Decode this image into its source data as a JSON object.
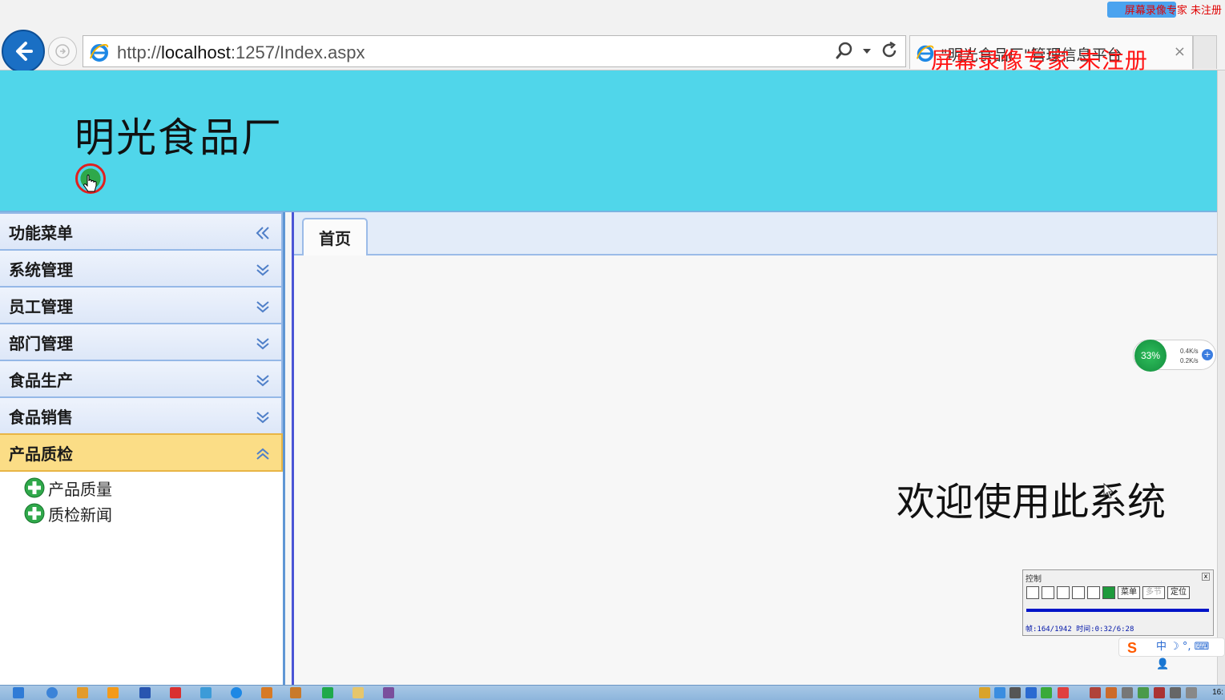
{
  "browser": {
    "url_prefix": "http://",
    "url_host": "localhost",
    "url_rest": ":1257/Index.aspx",
    "tab_title": "\"明光食品厂\"管理信息平台",
    "tab_close": "×",
    "watermark": "屏幕录像专家 未注册",
    "watermark_small": "屏幕录像专家 未注册"
  },
  "header": {
    "brand": "明光食品厂"
  },
  "sidebar": {
    "title": "功能菜单",
    "items": [
      {
        "label": "系统管理",
        "expanded": false
      },
      {
        "label": "员工管理",
        "expanded": false
      },
      {
        "label": "部门管理",
        "expanded": false
      },
      {
        "label": "食品生产",
        "expanded": false
      },
      {
        "label": "食品销售",
        "expanded": false
      },
      {
        "label": "产品质检",
        "expanded": true
      }
    ],
    "tree": [
      {
        "label": "产品质量"
      },
      {
        "label": "质检新闻"
      }
    ]
  },
  "main": {
    "tab_home": "首页",
    "welcome": "欢迎使用此系统"
  },
  "net_widget": {
    "percent": "33%",
    "up": "0.4K/s",
    "down": "0.2K/s",
    "plus": "+"
  },
  "recorder": {
    "title": "控制",
    "close": "x",
    "btn_menu": "菜单",
    "btn_multi": "多节",
    "btn_locate": "定位",
    "info": "帧:164/1942 时间:0:32/6:28"
  },
  "ime": {
    "logo": "S",
    "text": "中 ☽ °, ⌨ 👤"
  },
  "taskbar": {
    "clock": "16:"
  },
  "colors": {
    "header_bg": "#50d6ea",
    "sidebar_active": "#fbdd86",
    "accent_blue": "#5f96d4",
    "watermark_red": "#ff1414"
  }
}
